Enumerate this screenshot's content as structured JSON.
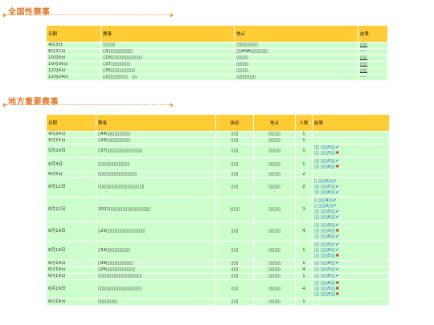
{
  "national": {
    "title": "全国性赛事",
    "headers": [
      "日期",
      "赛事",
      "地点",
      "结果"
    ],
    "rows": [
      {
        "date": "4月3日",
        "event": "▯▯▯▯▯",
        "venue": "▯▯▯▯▯▯▯▯▯",
        "result": "▯▯▯"
      },
      {
        "date": "8月21日",
        "event": "▯3▯▯▯▯▯▯▯▯▯▯",
        "venue": "▯▯ANA▯▯▯▯▯▯▯",
        "result": "----"
      },
      {
        "date": "10月9日",
        "event": "▯18▯▯▯▯▯▯▯▯▯▯▯▯▯",
        "venue": "▯▯▯▯▯",
        "result": "▯▯▯"
      },
      {
        "date": "10月30日",
        "event": "▯37▯▯▯▯▯▯▯▯",
        "venue": "▯▯▯▯▯",
        "result": "▯▯▯"
      },
      {
        "date": "12月4日",
        "event": "▯35▯▯▯▯▯▯▯▯▯▯",
        "venue": "▯▯▯▯▯",
        "result": "▯▯▯"
      },
      {
        "date": "12月24日",
        "event": "▯2▯▯▯▯▯▯▯▯　▯▯",
        "venue": "▯▯▯▯▯▯▯▯",
        "result": "----"
      }
    ]
  },
  "local": {
    "title": "地方重要赛事",
    "headers": [
      "日期",
      "赛事",
      "级别",
      "地点",
      "人数",
      "结果"
    ],
    "rows": [
      {
        "date": "4月24日",
        "event": "▯44▯▯▯▯▯▯▯▯▯▯",
        "level": "▯▯▯",
        "venue": "▯▯▯▯▯",
        "count": "1",
        "results": []
      },
      {
        "date": "5月15日",
        "event": "▯26▯▯▯▯▯▯▯▯▯▯",
        "level": "▯▯▯",
        "venue": "▯▯▯▯▯",
        "count": "1",
        "results": []
      },
      {
        "date": "5月29日",
        "event": "▯37▯▯▯▯▯▯▯▯▯▯▯▯▯▯▯",
        "level": "▯▯▯",
        "venue": "▯▯▯▯▯",
        "count": "1",
        "results": [
          {
            "t": "▯▯ ▯▯▯5▯▯",
            "m": "✔"
          },
          {
            "t": "▯▯ ▯▯▯5▯▯",
            "m": "✖"
          }
        ]
      },
      {
        "date": "6月4日",
        "event": "▯▯▯▯▯▯▯▯▯▯▯▯▯",
        "level": "▯▯▯",
        "venue": "▯▯▯▯▯",
        "count": "1",
        "results": [
          {
            "t": "▯▯ ▯▯▯5▯▯",
            "m": "✔"
          },
          {
            "t": "▯▯ ▯▯▯6▯▯",
            "m": "✖"
          }
        ]
      },
      {
        "date": "6月5日",
        "event": "▯▯▯▯▯▯▯▯▯▯▯▯▯▯▯▯",
        "level": "▯▯▯",
        "venue": "▯▯▯▯▯",
        "count": "2",
        "results": []
      },
      {
        "date": "6月12日",
        "event": "▯▯▯▯▯▯▯▯▯▯▯▯▯▯▯▯▯▯▯",
        "level": "▯▯▯",
        "venue": "▯▯▯▯▯",
        "count": "2",
        "results": [
          {
            "t": "▯ ▯▯▯5▯▯",
            "m": "✔"
          },
          {
            "t": "▯▯ ▯▯▯5▯▯",
            "m": "✔"
          },
          {
            "t": "▯▯ ▯▯▯6▯▯",
            "m": "✔"
          }
        ]
      },
      {
        "date": "6月12日",
        "event": "2022▯▯▯▯▯▯▯▯▯▯▯▯▯▯▯▯▯",
        "level": "▯▯▯▯",
        "venue": "▯▯▯▯▯",
        "count": "3",
        "results": [
          {
            "t": "▯ ▯▯▯4▯▯",
            "m": "✔"
          },
          {
            "t": "▯ ▯▯▯5▯▯",
            "m": "✔"
          },
          {
            "t": "▯▯ ▯▯▯5▯▯",
            "m": "✔"
          },
          {
            "t": "▯▯ ▯▯▯6▯▯",
            "m": "✔"
          }
        ]
      },
      {
        "date": "6月19日",
        "event": "▯29▯▯▯▯▯▯▯▯▯▯▯▯▯▯▯▯",
        "level": "▯▯▯",
        "venue": "▯▯▯▯▯",
        "count": "4",
        "results": [
          {
            "t": "▯▯ ▯▯▯5▯▯",
            "m": "✔"
          },
          {
            "t": "▯▯ ▯▯▯5▯▯",
            "m": "✖"
          },
          {
            "t": "▯▯ ▯▯▯6▯▯",
            "m": "✔"
          }
        ]
      },
      {
        "date": "6月19日",
        "event": "▯34▯▯▯▯▯▯▯▯▯▯",
        "level": "▯▯▯",
        "venue": "▯▯▯▯▯",
        "count": "1",
        "results": [
          {
            "t": "▯▯ ▯▯▯5▯▯",
            "m": "✔"
          },
          {
            "t": "▯▯ ▯▯▯6▯▯",
            "m": "✔"
          },
          {
            "t": "▯▯ ▯▯▯5▯▯",
            "m": "✖"
          }
        ]
      },
      {
        "date": "6月19日",
        "event": "▯38▯▯▯▯▯▯▯▯▯▯▯",
        "level": "▯▯▯",
        "venue": "▯▯▯▯▯",
        "count": "1",
        "results": [
          {
            "t": "▯▯ ▯▯▯6▯▯",
            "m": "✔"
          }
        ]
      },
      {
        "date": "6月19日",
        "event": "▯26▯▯▯▯▯▯▯▯▯▯▯▯",
        "level": "▯▯▯",
        "venue": "▯▯▯▯▯",
        "count": "4",
        "results": [
          {
            "t": "▯▯ ▯▯▯5▯▯",
            "m": "✔"
          }
        ]
      },
      {
        "date": "6月19日",
        "event": "▯▯▯▯▯▯▯▯▯▯▯▯▯▯▯▯▯▯",
        "level": "▯▯▯",
        "venue": "▯▯▯▯▯",
        "count": "1",
        "results": [
          {
            "t": "▯▯ ▯▯▯6▯▯",
            "m": "✔"
          }
        ]
      },
      {
        "date": "6月19日",
        "event": "▯▯▯▯▯▯▯▯▯▯▯▯▯▯▯▯▯▯",
        "level": "▯▯▯",
        "venue": "▯▯▯▯▯",
        "count": "4",
        "results": [
          {
            "t": "▯▯ ▯▯▯6▯▯",
            "m": "✖"
          },
          {
            "t": "▯▯ ▯▯▯5▯▯",
            "m": "✖"
          },
          {
            "t": "▯▯ ▯▯▯5▯▯",
            "m": "✖"
          }
        ]
      },
      {
        "date": "6月19日",
        "event": "▯▯▯▯▯▯▯▯",
        "level": "▯▯▯",
        "venue": "▯▯▯▯▯",
        "count": "1",
        "results": []
      }
    ]
  },
  "colors": {
    "header": "#ffcc33",
    "row": "#ccffcc",
    "title": "#e07a2c",
    "ok": "#2255cc",
    "ng": "#cc2222"
  }
}
